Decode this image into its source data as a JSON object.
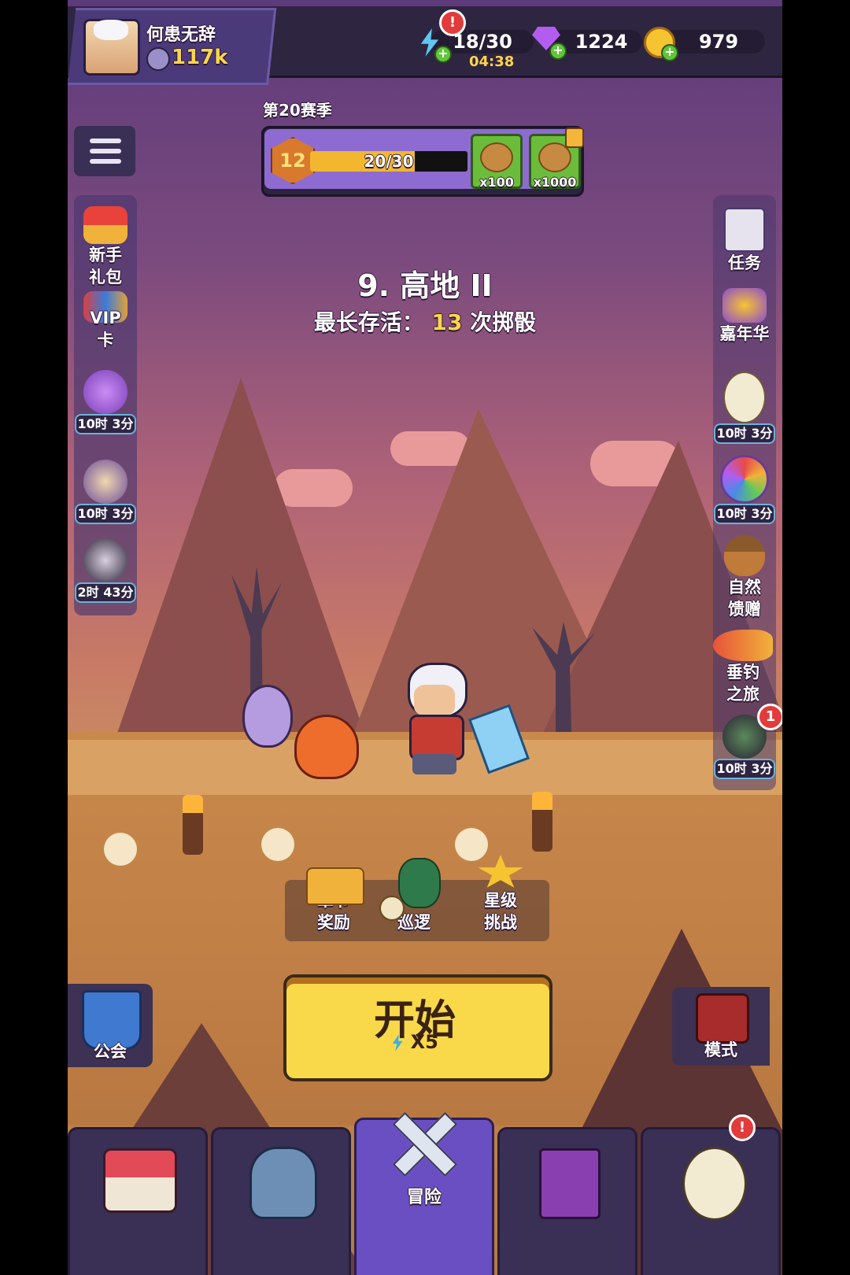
{
  "player": {
    "name": "何患无辞",
    "power": "117k"
  },
  "resources": {
    "energy": {
      "value": "18/30",
      "timer": "04:38",
      "alert": "!"
    },
    "gems": {
      "value": "1224"
    },
    "coins": {
      "value": "979"
    }
  },
  "season": {
    "label": "第20赛季",
    "level": "12",
    "progress_text": "20/30",
    "progress_fraction": 0.667,
    "rewards": [
      {
        "qty": "x100"
      },
      {
        "qty": "x1000"
      }
    ]
  },
  "stage": {
    "title": "9. 高地 II",
    "survive_prefix": "最长存活：",
    "survive_count": "13",
    "survive_suffix": "次掷骰"
  },
  "left_sidebar": [
    {
      "label_line1": "新手",
      "label_line2": "礼包",
      "icon": "gift-icon"
    },
    {
      "label_line1": "VIP",
      "label_line2": "卡",
      "icon": "vip-card-icon"
    },
    {
      "timer": "10时 3分",
      "icon": "gem-chest-icon"
    },
    {
      "timer": "10时 3分",
      "icon": "old-merchant-icon"
    },
    {
      "timer": "2时 43分",
      "icon": "dark-merchant-icon"
    }
  ],
  "right_sidebar": [
    {
      "label_line1": "任务",
      "icon": "tasks-icon"
    },
    {
      "label_line1": "嘉年华",
      "icon": "carnival-icon"
    },
    {
      "timer": "10时 3分",
      "icon": "egg-icon"
    },
    {
      "timer": "10时 3分",
      "icon": "wheel-icon"
    },
    {
      "label_line1": "自然",
      "label_line2": "馈赠",
      "icon": "acorn-icon"
    },
    {
      "label_line1": "垂钓",
      "label_line2": "之旅",
      "icon": "fish-icon"
    },
    {
      "timer": "10时 3分",
      "badge": "1",
      "icon": "plague-doctor-icon"
    }
  ],
  "chapter": {
    "reward_line1": "章节",
    "reward_line2": "奖励",
    "patrol": "巡逻",
    "star_line1": "星级",
    "star_line2": "挑战"
  },
  "start": {
    "label": "开始",
    "cost": "X5"
  },
  "guild": {
    "label": "公会"
  },
  "mode": {
    "label": "模式"
  },
  "nav": {
    "adventure": "冒险",
    "egg_alert": "!"
  },
  "colors": {
    "accent": "#f9d94a",
    "nav_active": "#6a4fc2",
    "panel": "#3a2f55"
  }
}
